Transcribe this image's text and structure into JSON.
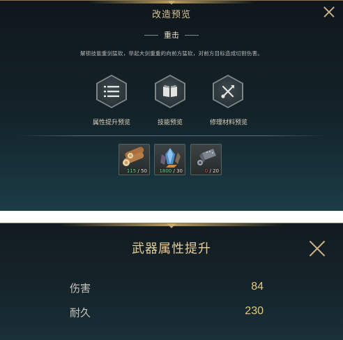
{
  "upgrade_preview": {
    "title": "改造预览",
    "skill_name": "重击",
    "description": "解锁技能重剑猛砍，举起大剑重重的向前方猛砍，对前方目标造成切割伤害。",
    "options": [
      {
        "label": "属性提升预览",
        "icon": "list-icon"
      },
      {
        "label": "技能预览",
        "icon": "book-icon"
      },
      {
        "label": "修理材料预览",
        "icon": "tools-icon"
      }
    ],
    "materials": [
      {
        "icon": "wood-logs-icon",
        "have": "115",
        "need": "/ 50",
        "status": "ok"
      },
      {
        "icon": "crystal-ore-icon",
        "have": "1800",
        "need": "/ 30",
        "status": "ok"
      },
      {
        "icon": "metal-part-icon",
        "have": "0",
        "need": "/ 20",
        "status": "bad"
      }
    ]
  },
  "weapon_stats": {
    "title": "武器属性提升",
    "stats": [
      {
        "name": "伤害",
        "value": "84"
      },
      {
        "name": "耐久",
        "value": "230"
      }
    ]
  },
  "colors": {
    "accent_gold": "#d9c398",
    "value_gold": "#e7c978",
    "ok_green": "#5fdc8a",
    "warn_red": "#e65050"
  }
}
